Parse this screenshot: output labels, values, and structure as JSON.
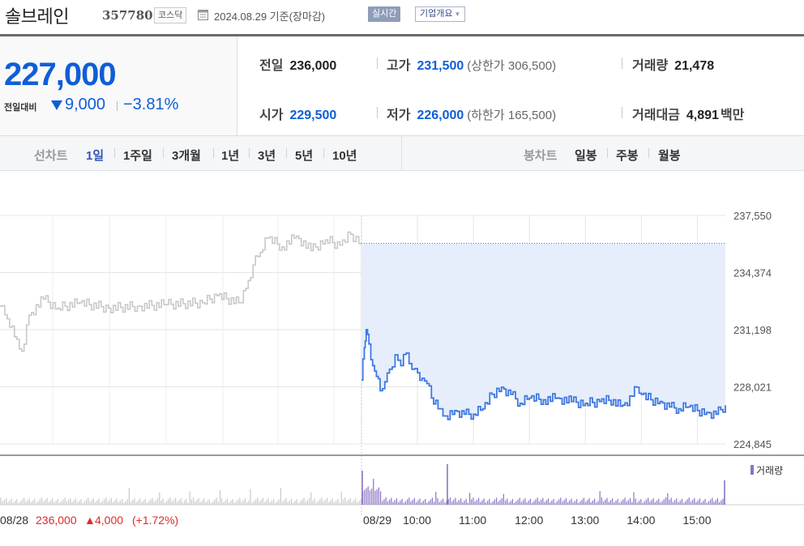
{
  "header": {
    "name": "솔브레인",
    "code": "357780",
    "market": "코스닥",
    "base_date": "2024.08.29 기준(장마감)",
    "realtime_label": "실시간",
    "company_info_label": "기업개요"
  },
  "price": {
    "current": "227,000",
    "compare_label": "전일대비",
    "change": "9,000",
    "rate": "−3.81%",
    "direction": "down"
  },
  "stats": {
    "prev_close": {
      "label": "전일",
      "value": "236,000"
    },
    "high": {
      "label": "고가",
      "value": "231,500",
      "limit": "(상한가 306,500)"
    },
    "volume": {
      "label": "거래량",
      "value": "21,478"
    },
    "open": {
      "label": "시가",
      "value": "229,500"
    },
    "low": {
      "label": "저가",
      "value": "226,000",
      "limit": "(하한가 165,500)"
    },
    "amount": {
      "label": "거래대금",
      "value": "4,891",
      "unit": "백만"
    }
  },
  "period_tabs": {
    "label": "선차트",
    "items": [
      "1일",
      "1주일",
      "3개월",
      "1년",
      "3년",
      "5년",
      "10년"
    ],
    "active": "1일"
  },
  "candle_tabs": {
    "label": "봉차트",
    "items": [
      "일봉",
      "주봉",
      "월봉"
    ]
  },
  "colors": {
    "up": "#e0292b",
    "down": "#1f5fd6",
    "today_line": "#3f78e0",
    "today_fill": "#e6eefb",
    "prev_line": "#c8c8c8",
    "volume_today": "#8a73c4",
    "volume_prev": "#c9c9c9"
  },
  "chart_data": {
    "type": "line",
    "y_ticks": [
      "237,550",
      "234,374",
      "231,198",
      "228,021",
      "224,845"
    ],
    "ylim": [
      224845,
      237550
    ],
    "prev_close": 236000,
    "volume_label": "거래량",
    "prev_day": {
      "date": "08/28",
      "close": "236,000",
      "change": "4,000",
      "rate": "(+1.72%)",
      "series": [
        {
          "t": 0,
          "price": 232500
        },
        {
          "t": 0.02,
          "price": 231800
        },
        {
          "t": 0.04,
          "price": 230800
        },
        {
          "t": 0.06,
          "price": 230000
        },
        {
          "t": 0.08,
          "price": 232000
        },
        {
          "t": 0.12,
          "price": 232900
        },
        {
          "t": 0.16,
          "price": 232400
        },
        {
          "t": 0.22,
          "price": 232700
        },
        {
          "t": 0.3,
          "price": 232400
        },
        {
          "t": 0.38,
          "price": 232500
        },
        {
          "t": 0.46,
          "price": 232600
        },
        {
          "t": 0.56,
          "price": 232700
        },
        {
          "t": 0.6,
          "price": 233100
        },
        {
          "t": 0.66,
          "price": 232700
        },
        {
          "t": 0.68,
          "price": 233500
        },
        {
          "t": 0.7,
          "price": 234800
        },
        {
          "t": 0.72,
          "price": 235500
        },
        {
          "t": 0.74,
          "price": 236300
        },
        {
          "t": 0.78,
          "price": 235800
        },
        {
          "t": 0.82,
          "price": 236400
        },
        {
          "t": 0.86,
          "price": 235600
        },
        {
          "t": 0.9,
          "price": 236200
        },
        {
          "t": 0.94,
          "price": 235900
        },
        {
          "t": 0.97,
          "price": 236500
        },
        {
          "t": 1,
          "price": 236000
        }
      ]
    },
    "today": {
      "date": "08/29",
      "x_ticks": [
        "08/29",
        "10:00",
        "11:00",
        "12:00",
        "13:00",
        "14:00",
        "15:00"
      ],
      "series": [
        {
          "time": "09:00",
          "price": 228400
        },
        {
          "time": "09:03",
          "price": 230200
        },
        {
          "time": "09:05",
          "price": 231200
        },
        {
          "time": "09:08",
          "price": 230400
        },
        {
          "time": "09:12",
          "price": 229200
        },
        {
          "time": "09:16",
          "price": 228600
        },
        {
          "time": "09:20",
          "price": 227800
        },
        {
          "time": "09:25",
          "price": 228300
        },
        {
          "time": "09:30",
          "price": 229000
        },
        {
          "time": "09:36",
          "price": 229800
        },
        {
          "time": "09:42",
          "price": 229200
        },
        {
          "time": "09:48",
          "price": 229900
        },
        {
          "time": "09:54",
          "price": 229000
        },
        {
          "time": "10:00",
          "price": 228800
        },
        {
          "time": "10:05",
          "price": 228500
        },
        {
          "time": "10:10",
          "price": 228200
        },
        {
          "time": "10:15",
          "price": 227400
        },
        {
          "time": "10:22",
          "price": 226800
        },
        {
          "time": "10:30",
          "price": 226400
        },
        {
          "time": "10:40",
          "price": 226700
        },
        {
          "time": "10:50",
          "price": 226500
        },
        {
          "time": "11:00",
          "price": 226500
        },
        {
          "time": "11:10",
          "price": 226800
        },
        {
          "time": "11:20",
          "price": 227600
        },
        {
          "time": "11:30",
          "price": 228000
        },
        {
          "time": "11:40",
          "price": 227600
        },
        {
          "time": "11:50",
          "price": 227100
        },
        {
          "time": "12:00",
          "price": 227400
        },
        {
          "time": "12:15",
          "price": 227300
        },
        {
          "time": "12:30",
          "price": 227400
        },
        {
          "time": "12:45",
          "price": 227200
        },
        {
          "time": "13:00",
          "price": 227100
        },
        {
          "time": "13:15",
          "price": 227200
        },
        {
          "time": "13:30",
          "price": 227300
        },
        {
          "time": "13:40",
          "price": 227000
        },
        {
          "time": "13:50",
          "price": 227500
        },
        {
          "time": "13:55",
          "price": 228000
        },
        {
          "time": "14:00",
          "price": 227600
        },
        {
          "time": "14:10",
          "price": 227300
        },
        {
          "time": "14:20",
          "price": 227200
        },
        {
          "time": "14:30",
          "price": 226900
        },
        {
          "time": "14:40",
          "price": 226800
        },
        {
          "time": "14:50",
          "price": 226900
        },
        {
          "time": "15:00",
          "price": 226700
        },
        {
          "time": "15:10",
          "price": 226600
        },
        {
          "time": "15:20",
          "price": 226500
        },
        {
          "time": "15:30",
          "price": 227000
        }
      ]
    }
  }
}
